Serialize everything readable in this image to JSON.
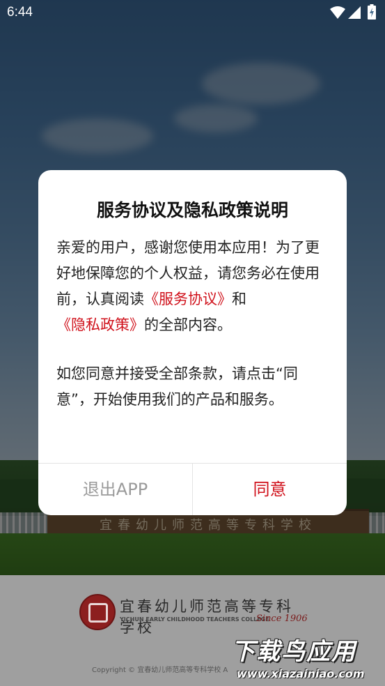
{
  "status_bar": {
    "time": "6:44"
  },
  "background": {
    "wall_sign": "宜春幼儿师范高等专科学校",
    "logo": {
      "name_cn": "宜春幼儿师范高等专科学校",
      "name_en": "YICHUN EARLY CHILDHOOD TEACHERS COLLEGE",
      "since": "Since 1906"
    },
    "copyright": "Copyright © 宜春幼儿师范高等专科学校 A"
  },
  "watermark": {
    "main": "下载鸟应用",
    "url": "www.xiazainiao.com"
  },
  "dialog": {
    "title": "服务协议及隐私政策说明",
    "para1": {
      "text1": "亲爱的用户，感谢您使用本应用！为了更好地保障您的个人权益，请您务必在使用前，认真阅读",
      "link_service": "《服务协议》",
      "text2": "和",
      "link_privacy": "《隐私政策》",
      "text3": "的全部内容。"
    },
    "para2": "如您同意并接受全部条款，请点击“同意”，开始使用我们的产品和服务。",
    "exit_label": "退出APP",
    "agree_label": "同意"
  },
  "colors": {
    "accent_red": "#d0111b",
    "disabled_gray": "#9a9a9a"
  }
}
